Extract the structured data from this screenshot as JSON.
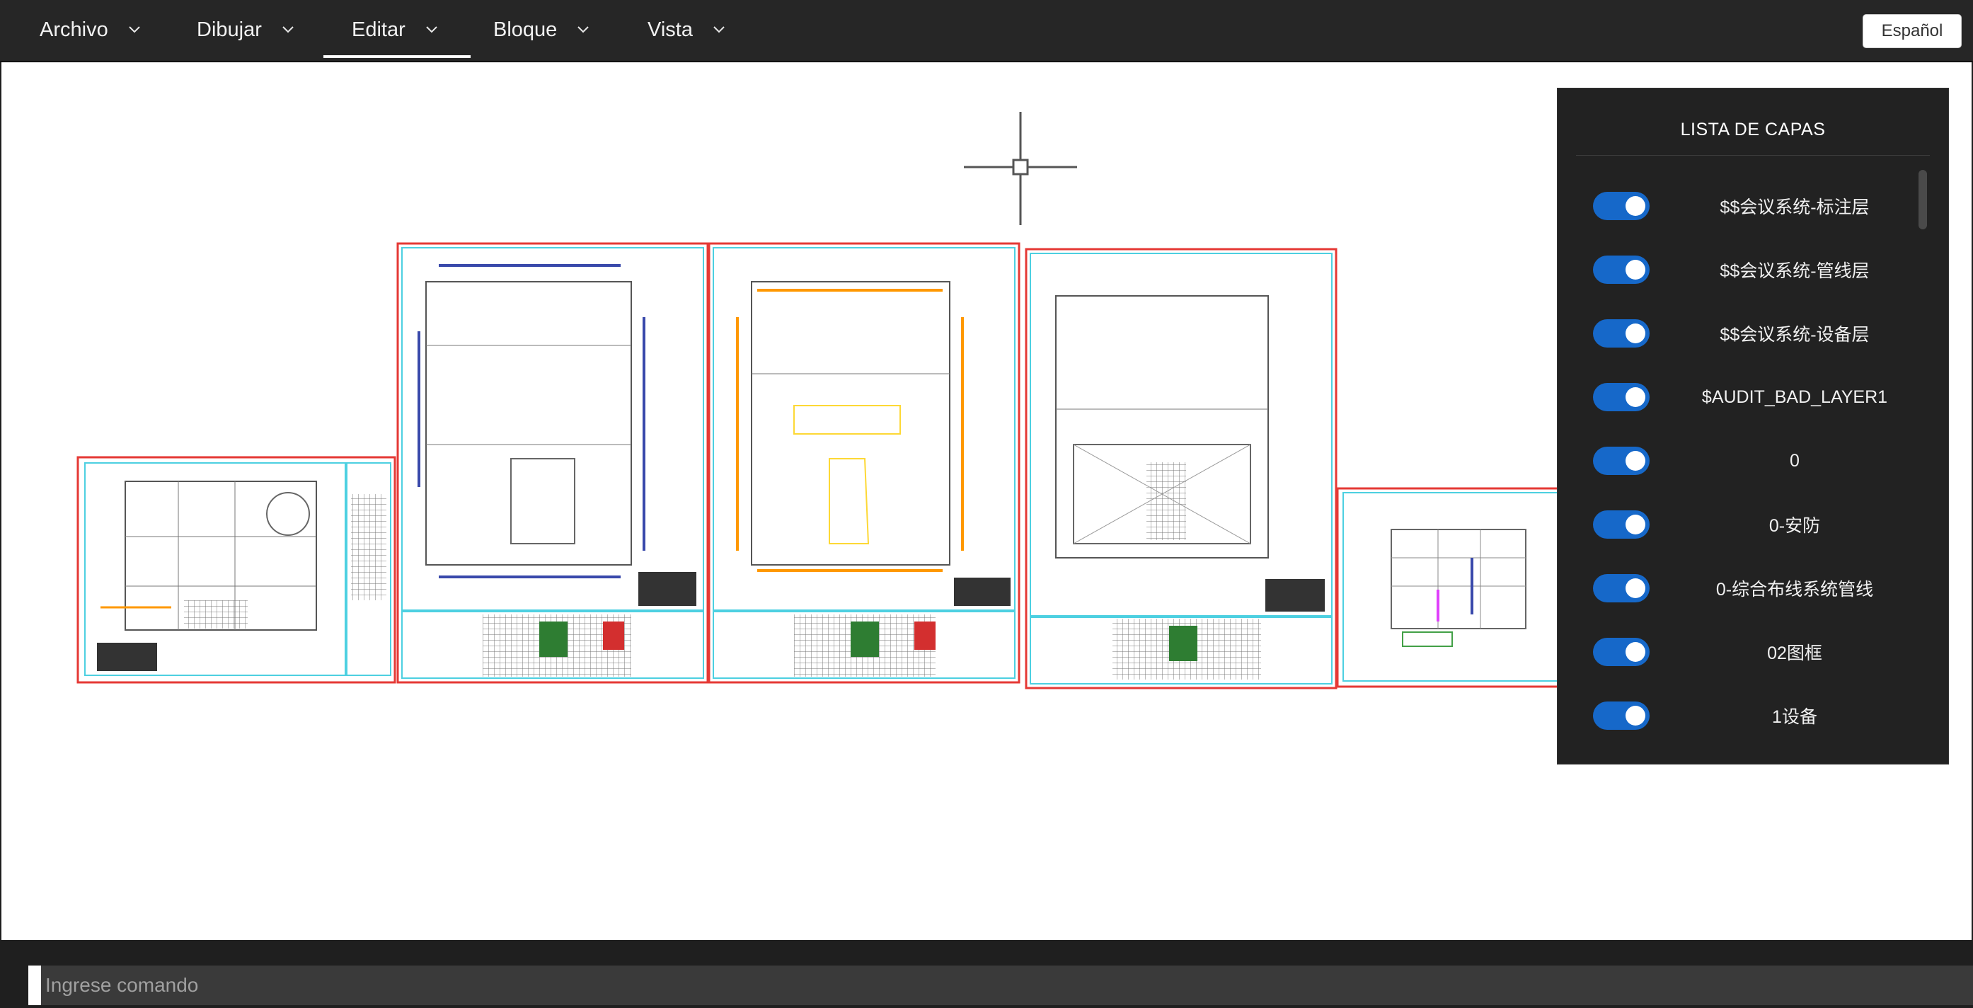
{
  "menu": {
    "items": [
      {
        "label": "Archivo"
      },
      {
        "label": "Dibujar"
      },
      {
        "label": "Editar"
      },
      {
        "label": "Bloque"
      },
      {
        "label": "Vista"
      }
    ],
    "active_item": "Editar",
    "language_button": "Español"
  },
  "layers_panel": {
    "title": "LISTA DE CAPAS",
    "layers": [
      {
        "name": "$$会议系统-标注层",
        "visible": true
      },
      {
        "name": "$$会议系统-管线层",
        "visible": true
      },
      {
        "name": "$$会议系统-设备层",
        "visible": true
      },
      {
        "name": "$AUDIT_BAD_LAYER1",
        "visible": true
      },
      {
        "name": "0",
        "visible": true
      },
      {
        "name": "0-安防",
        "visible": true
      },
      {
        "name": "0-综合布线系统管线",
        "visible": true
      },
      {
        "name": "02图框",
        "visible": true
      },
      {
        "name": "1设备",
        "visible": true
      }
    ]
  },
  "command": {
    "placeholder": "Ingrese comando",
    "value": ""
  },
  "colors": {
    "menubar_bg": "#262626",
    "panel_bg": "#222222",
    "toggle_on": "#1668c9",
    "sheet_border": "#e53935",
    "sheet_inner": "#4dd0e1"
  }
}
